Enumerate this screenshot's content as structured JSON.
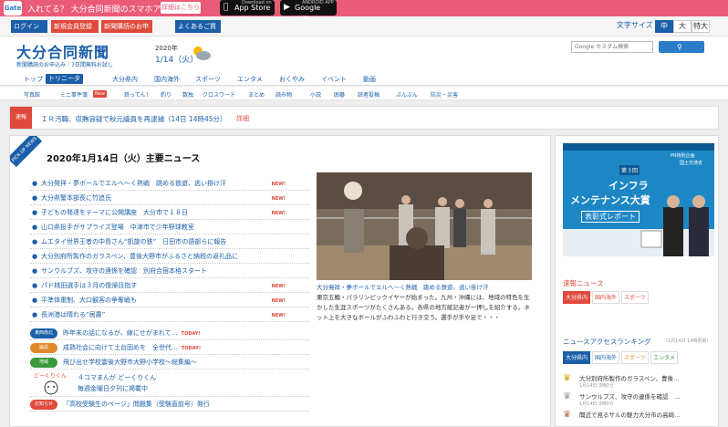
{
  "promo": {
    "gate_logo": "Gate",
    "text": "入れてる？ 大分合同新聞のスマホアプリ",
    "detail_button": "詳細はこちら",
    "appstore_small": "Download on the",
    "appstore": "App Store",
    "googleplay_small": "ANDROID APP ON",
    "googleplay": "Google play"
  },
  "topbar": {
    "login": "ログイン",
    "register1": "新規会員登録",
    "register2": "新聞購読のお申込",
    "faq": "よくあるご質問",
    "font_size_label": "文字サイズ",
    "font_small": "中",
    "font_mid": "大",
    "font_large": "特大"
  },
  "header": {
    "logo": "大分合同新聞",
    "tagline": "新聞購読のお申込み｜7日間無料お試し",
    "year": "2020年",
    "date": "1/14（火）",
    "search_placeholder": "Google カスタム検索",
    "search_icon": "search-icon"
  },
  "nav": {
    "items": [
      "トップ",
      "トリニータ",
      "大分県内",
      "国内海外",
      "スポーツ",
      "エンタメ",
      "おくやみ",
      "イベント",
      "動画"
    ],
    "sub_items": [
      "写真館",
      "ミニ事件簿",
      "鉄ってん！",
      "釣り",
      "数独",
      "クロスワード",
      "まとめ",
      "読み物",
      "小説",
      "囲碁",
      "読者投稿",
      "ぷんぷん",
      "防災・災害"
    ],
    "sub_new": "New"
  },
  "breaking": {
    "tag": "速報",
    "text": "ＩＲ汚職、収賄容疑で秋元議員を再逮捕（14日 14時45分）",
    "link": "詳細"
  },
  "main": {
    "ribbon": "PICK UP NEWS",
    "title": "2020年1月14日（火）主要ニュース",
    "news": [
      {
        "text": "大分発祥・夢ボールでエルへ～く熱戦　跳める鉄遊、逃い掛け汗",
        "new": "NEW!"
      },
      {
        "text": "大分県警本部長に竹追氏",
        "new": "NEW!"
      },
      {
        "text": "子どもの発達をテーマに公開講座　大分市で１８日",
        "new": "NEW!"
      },
      {
        "text": "山口県投手がサプライズ登場　中津市で少年野球教室",
        "new": ""
      },
      {
        "text": "ムエタイ世界王者の中島さん“凱旋の鉄”　日田市の語部らに報告",
        "new": ""
      },
      {
        "text": "大分別府所製作のガラスペン、豊後大野市がふるさと納税の返礼品に",
        "new": ""
      },
      {
        "text": "サンウルブズ、攻守の連係を確認　別府合宿本格スタート",
        "new": ""
      },
      {
        "text": "パド桃田選手は３月の復帰目指す",
        "new": "NEW!"
      },
      {
        "text": "平準体重制、大口観客の争奪戦も",
        "new": "NEW!"
      },
      {
        "text": "長洲港は晴れる“居農”",
        "new": "NEW!"
      }
    ],
    "categories": [
      {
        "tag": "東西南北",
        "color": "#1b5fa8",
        "text": "昨年末の話になるが、嫁にせがまれて…",
        "today": "TODAY!"
      },
      {
        "tag": "論説",
        "color": "#e0892a",
        "text": "成熟社会に向けて土台固めを　全世代…",
        "today": "TODAY!"
      },
      {
        "tag": "地域",
        "color": "#3a9a3a",
        "text": "飛び出せ学校震後大野市大野小学校～総集編～",
        "today": ""
      }
    ],
    "manga_char": "どーくりくん",
    "manga_t1": "４コマまんが どーくりくん",
    "manga_t2": "毎週金曜日夕刊に掲載中",
    "notice_tag": "お知らせ",
    "notice_color": "#e04a3c",
    "notice_text": "「高校受験生のページ」問題集（受験直前号）発行",
    "photo_caption": "大分発祥・夢ボールでエルへ～く熱戦　跳める鉄遊、逃い掛け汗",
    "photo_desc": "東京五輪・パラリンピックイヤーが始まった。九州・沖縄には、地域の特色を生かした生涯スポーツがたくさんある。各県の地方紙記者が一押しを紹介する。ネット上を大きなボールがふわふわと行き交う。選手が手や足で・・・"
  },
  "side": {
    "banner_pr": "PR特別企画",
    "banner_sponsor": "国土交通省",
    "banner_badge": "第３回",
    "banner_t1": "インフラ",
    "banner_t2": "メンテナンス大賞",
    "banner_t3": "表彰式レポート",
    "breaking_title": "速報ニュース",
    "breaking_tabs": [
      "大分県内",
      "国内海外",
      "スポーツ"
    ],
    "ranking_title": "ニュースアクセスランキング",
    "ranking_note": "（1月14日 14時更新）",
    "ranking_tabs": [
      "大分県内",
      "国内海外",
      "スポーツ",
      "エンタメ"
    ],
    "ranking": [
      {
        "text": "大分別府所製作のガラスペン、豊後…",
        "date": "1月14日 3時0分"
      },
      {
        "text": "サンウルブズ、攻守の連係を確認　…",
        "date": "1月14日 3時0分"
      },
      {
        "text": "聞近で見るサルの魅力大分市の高崎…",
        "date": ""
      }
    ]
  }
}
